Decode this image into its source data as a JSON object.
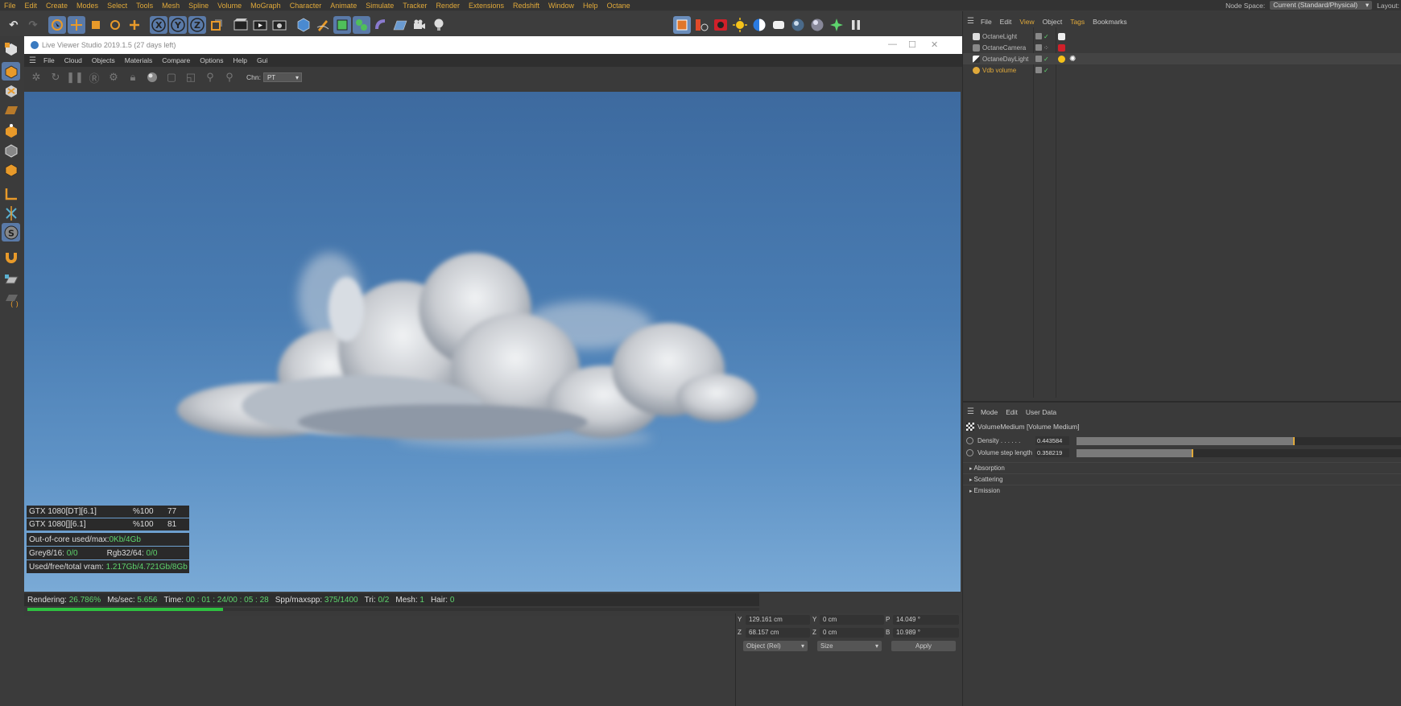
{
  "main_menu": [
    "File",
    "Edit",
    "Create",
    "Modes",
    "Select",
    "Tools",
    "Mesh",
    "Spline",
    "Volume",
    "MoGraph",
    "Character",
    "Animate",
    "Simulate",
    "Tracker",
    "Render",
    "Extensions",
    "Redshift",
    "Window",
    "Help",
    "Octane"
  ],
  "node_space": {
    "label": "Node Space:",
    "value": "Current (Standard/Physical)",
    "layout_label": "Layout:"
  },
  "live_viewer": {
    "title": "Live Viewer Studio 2019.1.5 (27 days left)",
    "menu": [
      "File",
      "Cloud",
      "Objects",
      "Materials",
      "Compare",
      "Options",
      "Help",
      "Gui"
    ],
    "channel_label": "Chn:",
    "channel_value": "PT",
    "gpus": [
      {
        "name": "GTX 1080[DT][6.1]",
        "usage": "%100",
        "temp": "77"
      },
      {
        "name": "GTX 1080[][6.1]",
        "usage": "%100",
        "temp": "81"
      }
    ],
    "out_of_core": {
      "label": "Out-of-core used/max:",
      "value": "0Kb/4Gb"
    },
    "grey": {
      "label": "Grey8/16:",
      "value": "0/0"
    },
    "rgb": {
      "label": "Rgb32/64:",
      "value": "0/0"
    },
    "vram": {
      "label": "Used/free/total vram:",
      "value": "1.217Gb/4.721Gb/8Gb"
    },
    "render": {
      "rendering_label": "Rendering:",
      "rendering_value": "26.786%",
      "ms_label": "Ms/sec:",
      "ms_value": "5.656",
      "time_label": "Time:",
      "time_value": "00 : 01 : 24/00 : 05 : 28",
      "spp_label": "Spp/maxspp:",
      "spp_value": "375/1400",
      "tri_label": "Tri:",
      "tri_value": "0/2",
      "mesh_label": "Mesh:",
      "mesh_value": "1",
      "hair_label": "Hair:",
      "hair_value": "0",
      "progress": 0.26786
    }
  },
  "coords": {
    "rows": [
      {
        "a_label": "Y",
        "a_value": "129.161 cm",
        "b_label": "Y",
        "b_value": "0 cm",
        "c_label": "P",
        "c_value": "14.049 °"
      },
      {
        "a_label": "Z",
        "a_value": "68.157 cm",
        "b_label": "Z",
        "b_value": "0 cm",
        "c_label": "B",
        "c_value": "10.989 °"
      }
    ],
    "mode": "Object (Rel)",
    "size": "Size",
    "apply": "Apply"
  },
  "object_manager": {
    "menu": [
      "File",
      "Edit",
      "View",
      "Object",
      "Tags",
      "Bookmarks"
    ],
    "objects": [
      {
        "name": "OctaneLight"
      },
      {
        "name": "OctaneCamera"
      },
      {
        "name": "OctaneDayLight"
      },
      {
        "name": "Vdb volume"
      }
    ]
  },
  "attributes": {
    "menu": [
      "Mode",
      "Edit",
      "User Data"
    ],
    "title": "VolumeMedium [Volume Medium]",
    "params": [
      {
        "label": "Density . . . . . .",
        "value": "0.443584",
        "level": 0.67
      },
      {
        "label": "Volume step length",
        "value": "0.358219",
        "level": 0.36
      }
    ],
    "sections": [
      "Absorption",
      "Scattering",
      "Emission"
    ]
  },
  "colors": {
    "accent": "#e0a93a",
    "progress": "#2ec040",
    "sky_top": "#3d6a9f",
    "sky_bottom": "#7aaad6"
  }
}
